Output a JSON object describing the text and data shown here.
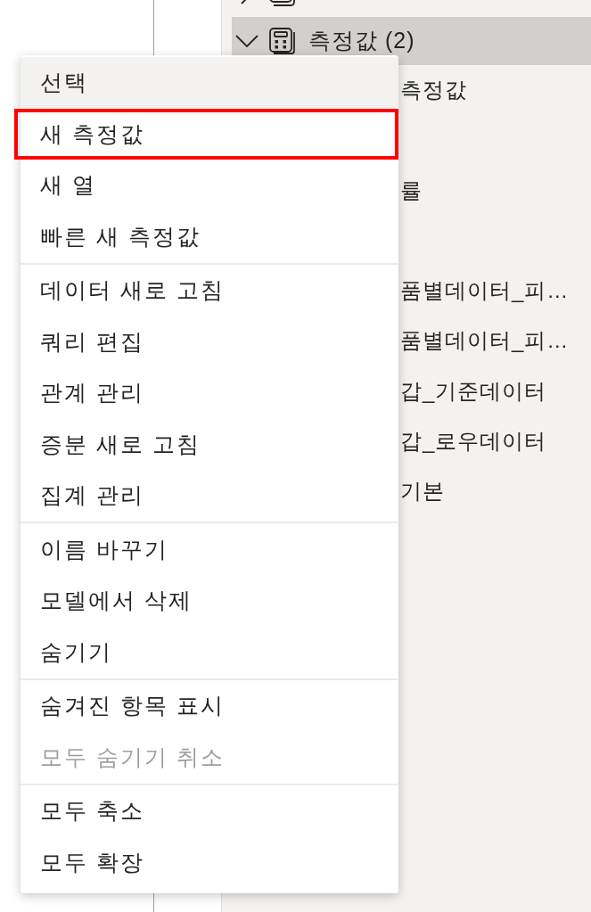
{
  "tree": [
    {
      "kind": "table",
      "expanded": false,
      "selected": false
    },
    {
      "kind": "measure_group",
      "label": "측정값 (2)",
      "expanded": true,
      "selected": true,
      "children": [
        {
          "kind": "measure",
          "label": "측정값"
        },
        {
          "kind": "covered"
        },
        {
          "kind": "measure",
          "label": "률"
        },
        {
          "kind": "covered"
        },
        {
          "kind": "measure",
          "label": "품별데이터_피…"
        },
        {
          "kind": "measure",
          "label": "품별데이터_피…"
        },
        {
          "kind": "measure",
          "label": "갑_기준데이터"
        },
        {
          "kind": "measure",
          "label": "갑_로우데이터"
        },
        {
          "kind": "measure",
          "label": "기본"
        }
      ]
    }
  ],
  "menu": {
    "groups": [
      {
        "items": [
          {
            "label": "선택",
            "highlighted": true,
            "disabled": false,
            "outlined": false
          },
          {
            "label": "새 측정값",
            "highlighted": false,
            "disabled": false,
            "outlined": true
          },
          {
            "label": "새 열",
            "highlighted": false,
            "disabled": false,
            "outlined": false
          },
          {
            "label": "빠른 새 측정값",
            "highlighted": false,
            "disabled": false,
            "outlined": false
          }
        ]
      },
      {
        "items": [
          {
            "label": "데이터 새로 고침",
            "highlighted": false,
            "disabled": false,
            "outlined": false
          },
          {
            "label": "쿼리 편집",
            "highlighted": false,
            "disabled": false,
            "outlined": false
          },
          {
            "label": "관계 관리",
            "highlighted": false,
            "disabled": false,
            "outlined": false
          },
          {
            "label": "증분 새로 고침",
            "highlighted": false,
            "disabled": false,
            "outlined": false
          },
          {
            "label": "집계 관리",
            "highlighted": false,
            "disabled": false,
            "outlined": false
          }
        ]
      },
      {
        "items": [
          {
            "label": "이름 바꾸기",
            "highlighted": false,
            "disabled": false,
            "outlined": false
          },
          {
            "label": "모델에서 삭제",
            "highlighted": false,
            "disabled": false,
            "outlined": false
          },
          {
            "label": "숨기기",
            "highlighted": false,
            "disabled": false,
            "outlined": false
          }
        ]
      },
      {
        "items": [
          {
            "label": "숨겨진 항목 표시",
            "highlighted": false,
            "disabled": false,
            "outlined": false
          },
          {
            "label": "모두 숨기기 취소",
            "highlighted": false,
            "disabled": true,
            "outlined": false
          }
        ]
      },
      {
        "items": [
          {
            "label": "모두 축소",
            "highlighted": false,
            "disabled": false,
            "outlined": false
          },
          {
            "label": "모두 확장",
            "highlighted": false,
            "disabled": false,
            "outlined": false
          }
        ]
      }
    ]
  }
}
